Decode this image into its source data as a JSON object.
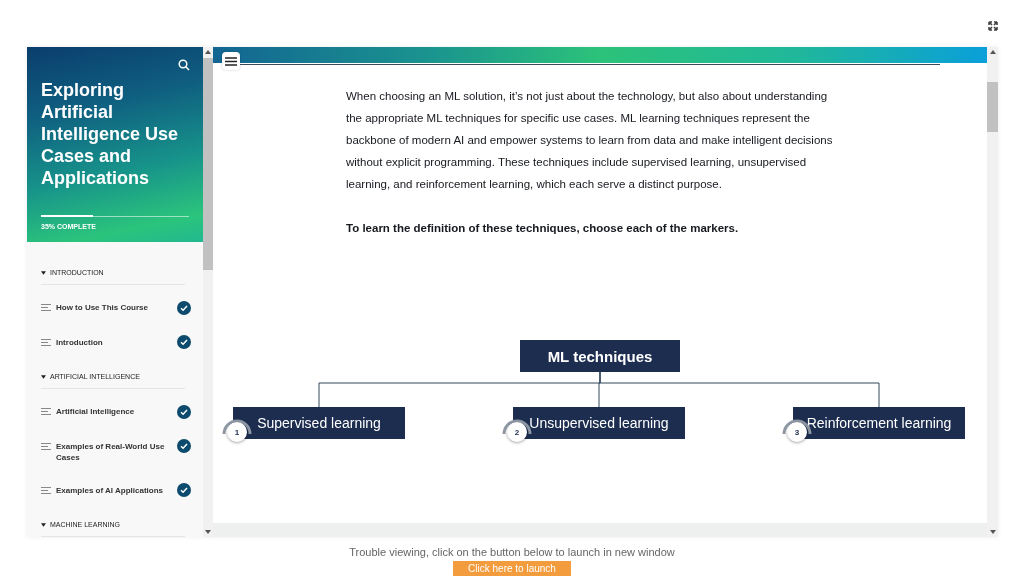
{
  "sidebar": {
    "title": "Exploring Artificial Intelligence Use Cases and Applications",
    "progress": {
      "level": 0.35,
      "label": "35% COMPLETE"
    },
    "sections": [
      {
        "title": "INTRODUCTION",
        "expanded": true,
        "items": [
          {
            "label": "How to Use This Course",
            "completed": true
          },
          {
            "label": "Introduction",
            "completed": true
          }
        ]
      },
      {
        "title": "ARTIFICIAL INTELLIGENCE",
        "expanded": true,
        "items": [
          {
            "label": "Artificial Intelligence",
            "completed": true
          },
          {
            "label": "Examples of Real-World Use Cases",
            "completed": true
          },
          {
            "label": "Examples of AI Applications",
            "completed": true
          }
        ]
      },
      {
        "title": "MACHINE LEARNING",
        "expanded": true
      }
    ]
  },
  "lesson": {
    "paragraph": "When choosing an ML solution, it’s not just about the technology, but also about understanding the appropriate ML techniques for specific use cases. ML learning techniques represent the backbone of modern AI and empower systems to learn from data and make intelligent decisions without explicit programming. These techniques include supervised learning, unsupervised learning, and reinforcement learning, which each serve a distinct purpose.",
    "instruction": "To learn the definition of these techniques, choose each of the markers.",
    "diagram": {
      "root": "ML techniques",
      "children": [
        {
          "label": "Supervised learning",
          "marker": "1"
        },
        {
          "label": "Unsupervised learning",
          "marker": "2"
        },
        {
          "label": "Reinforcement learning",
          "marker": "3"
        }
      ]
    }
  },
  "footer": {
    "notice": "Trouble viewing, click on the button below to launch in new window",
    "launch_button": "Click here to launch"
  }
}
